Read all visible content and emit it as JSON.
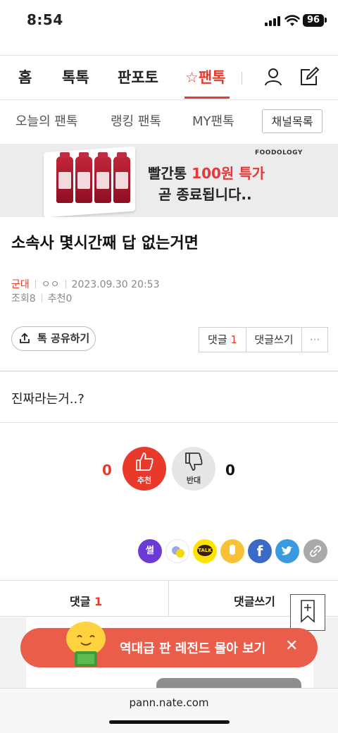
{
  "status_bar": {
    "time": "8:54",
    "battery": "96"
  },
  "nav": {
    "items": [
      "홈",
      "톡톡",
      "판포토"
    ],
    "active": "팬톡"
  },
  "subnav": {
    "items": [
      "오늘의 팬톡",
      "랭킹 팬톡",
      "MY팬톡"
    ],
    "channel_button": "채널목록"
  },
  "banner": {
    "brand": "FOODOLOGY",
    "line1_prefix": "빨간통 ",
    "line1_highlight": "100원 특가",
    "line2": "곧 종료됩니다.."
  },
  "post": {
    "title": "소속사 몇시간째 답 없는거면",
    "category": "군대",
    "author": "ㅇㅇ",
    "datetime": "2023.09.30 20:53",
    "views_label": "조회",
    "views": "8",
    "recommend_label": "추천",
    "recommend": "0",
    "body": "진짜라는거..?"
  },
  "actions": {
    "share": "톡 공유하기",
    "comments_label": "댓글",
    "comments_count": "1",
    "write_comment": "댓글쓰기",
    "more": "···"
  },
  "votes": {
    "up_count": "0",
    "up_label": "추천",
    "down_count": "0",
    "down_label": "반대"
  },
  "share_icons": [
    {
      "name": "ssul",
      "label": "썰",
      "color": "#6b3bd6"
    },
    {
      "name": "band",
      "label": "",
      "color": "#ffffff"
    },
    {
      "name": "kakaotalk",
      "label": "TALK",
      "color": "#fee500"
    },
    {
      "name": "kakaostory",
      "label": "",
      "color": "#f7c236"
    },
    {
      "name": "facebook",
      "label": "f",
      "color": "#3b69c8"
    },
    {
      "name": "twitter",
      "label": "",
      "color": "#3a9ae0"
    },
    {
      "name": "link",
      "label": "",
      "color": "#a9a9a9"
    }
  ],
  "bottom_tabs": {
    "comments_label": "댓글",
    "comments_count": "1",
    "write_comment": "댓글쓰기"
  },
  "toast": {
    "text": "역대급 판 레전드 몰아 보기"
  },
  "browser": {
    "url": "pann.nate.com"
  }
}
